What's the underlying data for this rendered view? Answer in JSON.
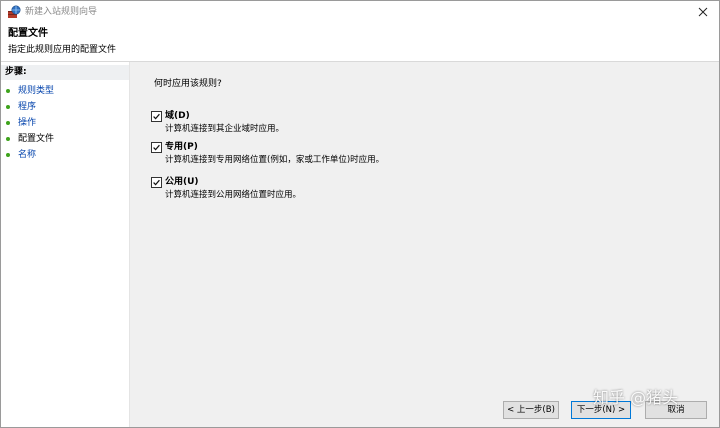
{
  "window": {
    "title": "新建入站规则向导"
  },
  "header": {
    "title": "配置文件",
    "subtitle": "指定此规则应用的配置文件"
  },
  "steps": {
    "title": "步骤:",
    "items": [
      {
        "label": "规则类型",
        "current": false
      },
      {
        "label": "程序",
        "current": false
      },
      {
        "label": "操作",
        "current": false
      },
      {
        "label": "配置文件",
        "current": true
      },
      {
        "label": "名称",
        "current": false
      }
    ]
  },
  "main": {
    "question": "何时应用该规则?",
    "options": [
      {
        "label": "域(D)",
        "description": "计算机连接到其企业域时应用。",
        "checked": true
      },
      {
        "label": "专用(P)",
        "description": "计算机连接到专用网络位置(例如，家或工作单位)时应用。",
        "checked": true
      },
      {
        "label": "公用(U)",
        "description": "计算机连接到公用网络位置时应用。",
        "checked": true
      }
    ]
  },
  "buttons": {
    "back": "< 上一步(B)",
    "next": "下一步(N) >",
    "cancel": "取消"
  },
  "watermark": "知乎 @猪头",
  "colors": {
    "step_bullet": "#3ea31c",
    "step_link": "#0645ad",
    "panel_bg": "#f0f0f0",
    "steps_title_bg": "#eef0f2"
  }
}
